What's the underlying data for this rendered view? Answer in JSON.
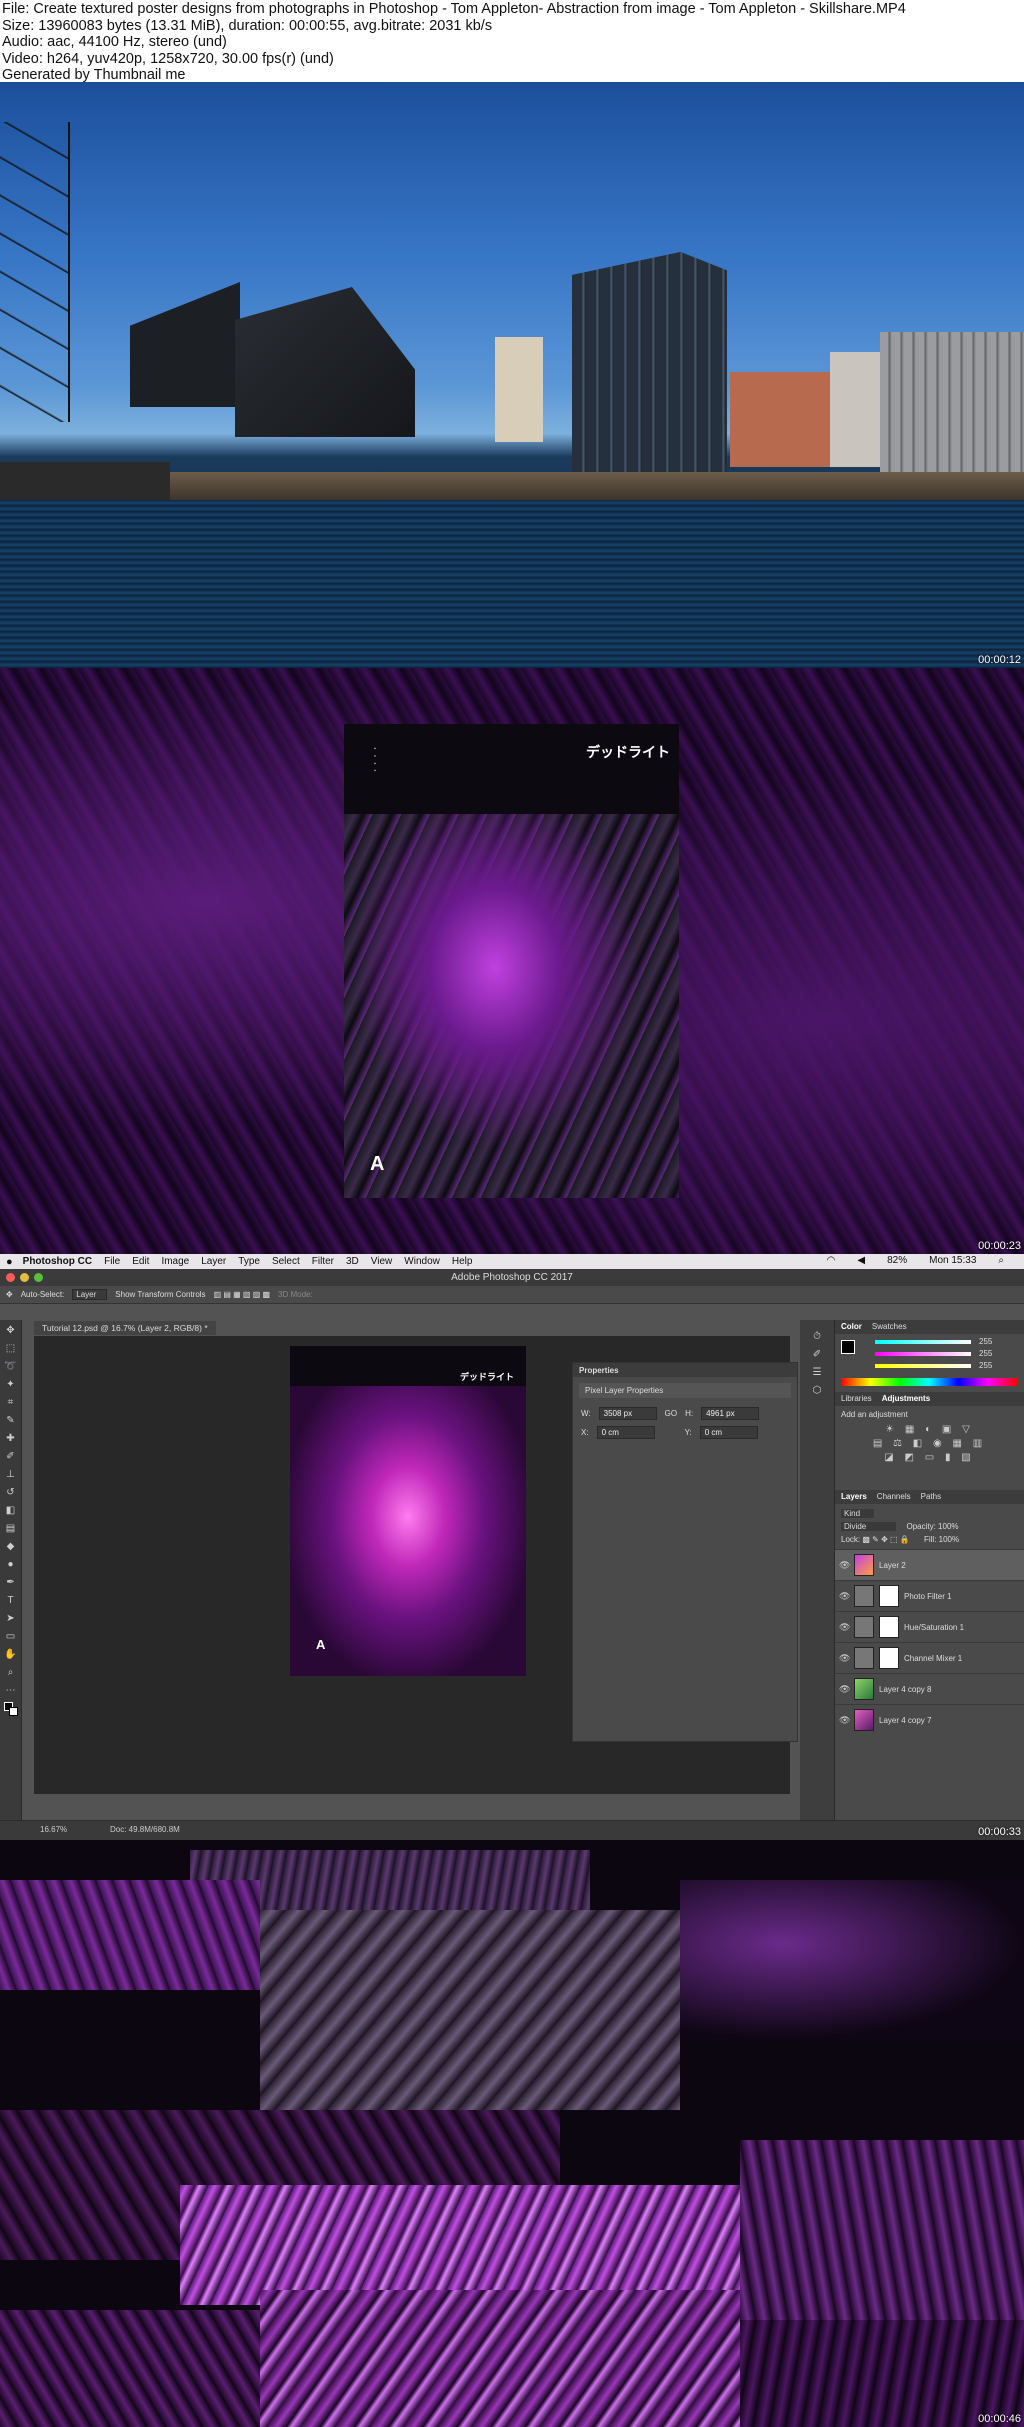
{
  "header": {
    "file_line": "File: Create textured poster designs from photographs in Photoshop - Tom Appleton- Abstraction from image - Tom Appleton - Skillshare.MP4",
    "size_line": "Size: 13960083 bytes (13.31 MiB), duration: 00:00:55, avg.bitrate: 2031 kb/s",
    "audio_line": "Audio: aac, 44100 Hz, stereo (und)",
    "video_line": "Video: h264, yuv420p, 1258x720, 30.00 fps(r) (und)",
    "generated_line": "Generated by Thumbnail me"
  },
  "frames": {
    "f1_time": "00:00:12",
    "f2_time": "00:00:23",
    "f3_time": "00:00:33",
    "f4_time": "00:00:46"
  },
  "poster": {
    "title_jp": "デッドライト",
    "logo": "A"
  },
  "photoshop": {
    "menubar": {
      "apple": "",
      "app": "Photoshop CC",
      "items": [
        "File",
        "Edit",
        "Image",
        "Layer",
        "Type",
        "Select",
        "Filter",
        "3D",
        "View",
        "Window",
        "Help"
      ],
      "battery": "82%",
      "clock": "Mon 15:33"
    },
    "window_title": "Adobe Photoshop CC 2017",
    "options": {
      "auto_select_label": "Auto-Select:",
      "auto_select_value": "Layer",
      "transform_label": "Show Transform Controls",
      "mode_3d": "3D Mode:"
    },
    "document_tab": "Tutorial 12.psd @ 16.7% (Layer 2, RGB/8) *",
    "status": {
      "zoom": "16.67%",
      "doc": "Doc: 49.8M/680.8M"
    },
    "properties": {
      "title": "Properties",
      "subtitle": "Pixel Layer Properties",
      "w_label": "W:",
      "w_value": "3508 px",
      "h_label": "H:",
      "h_value": "4961 px",
      "x_label": "X:",
      "x_value": "0 cm",
      "y_label": "Y:",
      "y_value": "0 cm",
      "link": "GO"
    },
    "color_panel": {
      "tabs": [
        "Color",
        "Swatches"
      ],
      "r": "255",
      "g": "255",
      "b": "255"
    },
    "adjust_panel": {
      "tabs": [
        "Libraries",
        "Adjustments"
      ],
      "hint": "Add an adjustment"
    },
    "layers_panel": {
      "tabs": [
        "Layers",
        "Channels",
        "Paths"
      ],
      "kind": "Kind",
      "blend": "Divide",
      "opacity_label": "Opacity:",
      "opacity": "100%",
      "lock_label": "Lock:",
      "fill_label": "Fill:",
      "fill": "100%",
      "layers": [
        {
          "name": "Layer 2",
          "selected": true
        },
        {
          "name": "Photo Filter 1",
          "selected": false
        },
        {
          "name": "Hue/Saturation 1",
          "selected": false
        },
        {
          "name": "Channel Mixer 1",
          "selected": false
        },
        {
          "name": "Layer 4 copy 8",
          "selected": false
        },
        {
          "name": "Layer 4 copy 7",
          "selected": false
        }
      ]
    }
  }
}
